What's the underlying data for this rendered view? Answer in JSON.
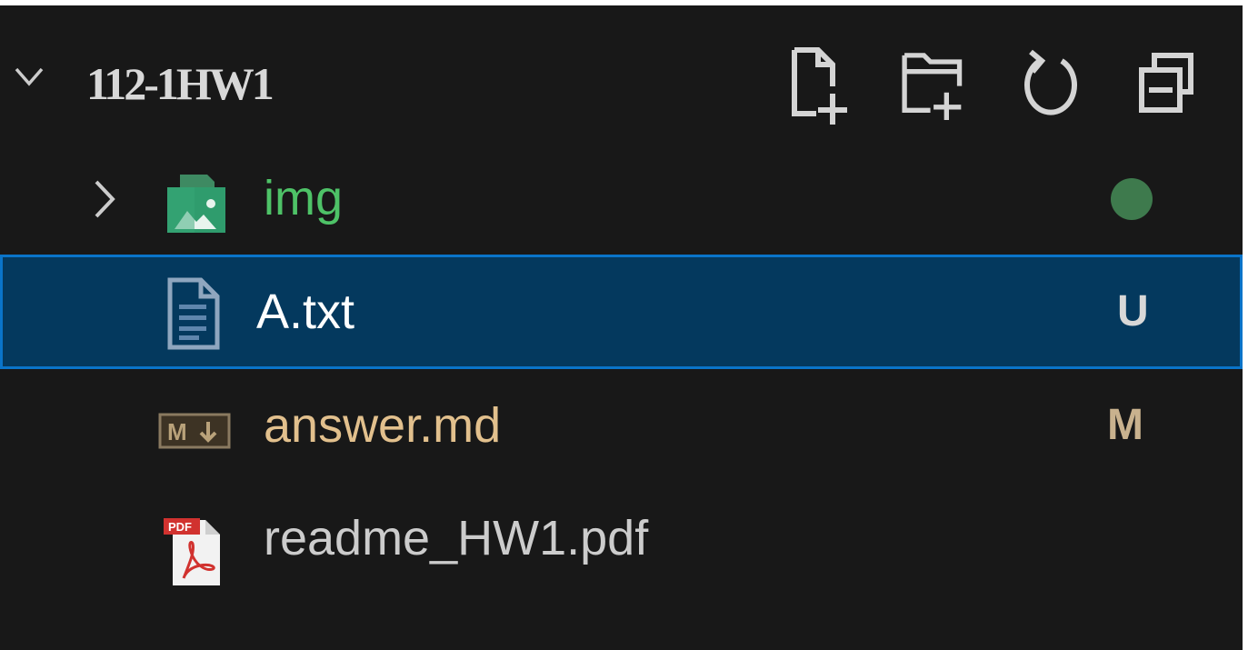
{
  "explorer": {
    "folder_name": "112-1HW1",
    "actions": {
      "new_file": "new-file-icon",
      "new_folder": "new-folder-icon",
      "refresh": "refresh-icon",
      "collapse_all": "collapse-all-icon"
    },
    "items": [
      {
        "label": "img",
        "kind": "folder",
        "icon": "image-folder-icon",
        "collapsed": true,
        "status": "modified-dot",
        "label_color": "#4ec267",
        "status_color": "#3e7a4d"
      },
      {
        "label": "A.txt",
        "kind": "file",
        "icon": "text-file-icon",
        "badge": "U",
        "selected": true,
        "label_color": "#ffffff",
        "badge_color": "#d8d8d8"
      },
      {
        "label": "answer.md",
        "kind": "file",
        "icon": "markdown-icon",
        "badge": "M",
        "label_color": "#e2c08d",
        "badge_color": "#c9b28e"
      },
      {
        "label": "readme_HW1.pdf",
        "kind": "file",
        "icon": "pdf-icon",
        "label_color": "#cccccc"
      }
    ]
  },
  "colors": {
    "background": "#181818",
    "selection_bg": "#04395e",
    "selection_border": "#0a74c9",
    "icon_fg": "#d4d4d4"
  }
}
